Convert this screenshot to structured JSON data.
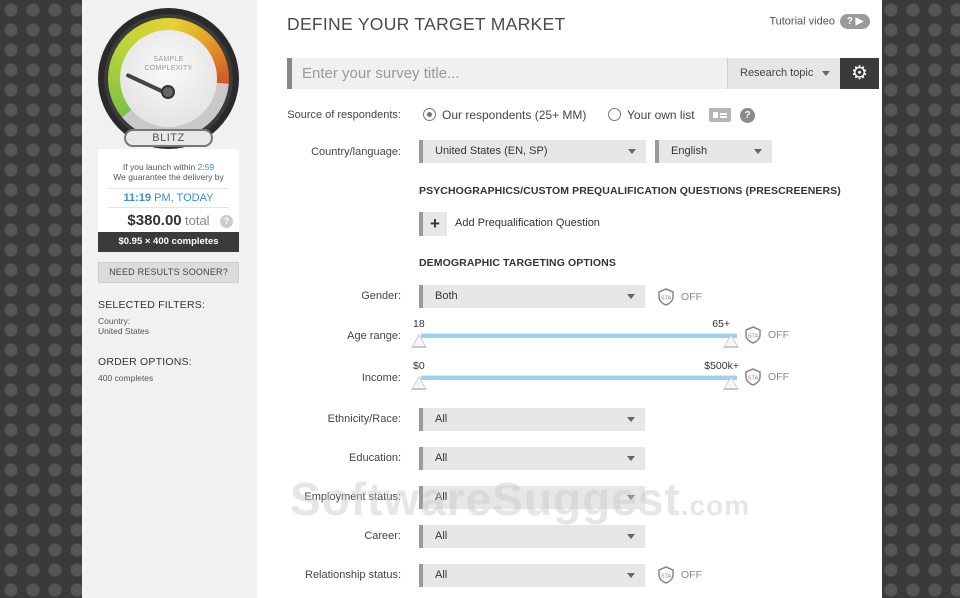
{
  "sidebar": {
    "gauge": {
      "label_line1": "SAMPLE",
      "label_line2": "COMPLEXITY",
      "speed": "BLITZ",
      "level": 0.25
    },
    "launch_prefix": "If you launch within",
    "launch_time": "2:59",
    "guarantee": "We guarantee the delivery by",
    "delivery_time": "11:19",
    "delivery_suffix": "PM, TODAY",
    "price": "$380.00",
    "price_suffix": "total",
    "help": "?",
    "rate": "$0.95 × 400 completes",
    "need_sooner": "NEED RESULTS SOONER?",
    "selected_filters_heading": "SELECTED FILTERS:",
    "filter_country_label": "Country:",
    "filter_country_value": "United States",
    "order_options_heading": "ORDER OPTIONS:",
    "order_options_value": "400 completes"
  },
  "main": {
    "title": "DEFINE YOUR TARGET MARKET",
    "tutorial_label": "Tutorial video",
    "tutorial_badge": "?",
    "survey_placeholder": "Enter your survey title...",
    "research_topic": "Research topic",
    "source_label": "Source of respondents:",
    "source_options": [
      "Our respondents (25+ MM)",
      "Your own list"
    ],
    "source_help": "?",
    "country_label": "Country/language:",
    "country_value": "United States (EN, SP)",
    "language_value": "English",
    "prescreen_heading": "PSYCHOGRAPHICS/CUSTOM PREQUALIFICATION QUESTIONS (PRESCREENERS)",
    "add_question": "Add Prequalification Question",
    "demographic_heading": "DEMOGRAPHIC TARGETING OPTIONS",
    "gender_label": "Gender:",
    "gender_value": "Both",
    "off": "OFF",
    "age_label": "Age range:",
    "age_min": "18",
    "age_max": "65+",
    "income_label": "Income:",
    "income_min": "$0",
    "income_max": "$500k+",
    "ethnicity_label": "Ethnicity/Race:",
    "ethnicity_value": "All",
    "education_label": "Education:",
    "education_value": "All",
    "employment_label": "Employment status:",
    "employment_value": "All",
    "career_label": "Career:",
    "career_value": "All",
    "relationship_label": "Relationship status:",
    "relationship_value": "All"
  },
  "watermark": {
    "text": "SoftwareSuggest",
    "suffix": ".com"
  }
}
